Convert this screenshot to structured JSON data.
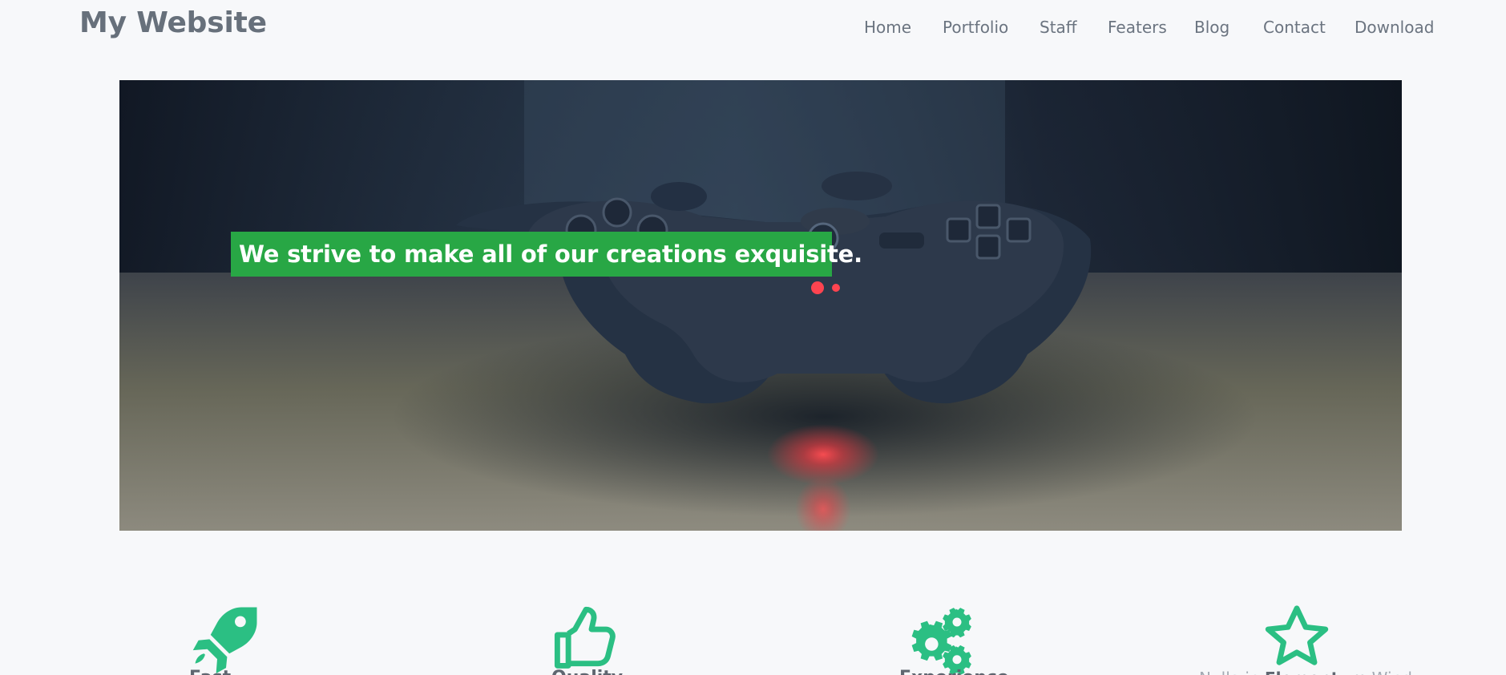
{
  "header": {
    "brand": "My Website",
    "nav": [
      {
        "label": "Home"
      },
      {
        "label": "Portfolio"
      },
      {
        "label": "Staff"
      },
      {
        "label": "Featers"
      },
      {
        "label": "Blog"
      },
      {
        "label": "Contact"
      },
      {
        "label": "Download"
      }
    ]
  },
  "hero": {
    "caption": "We strive to make all of our creations exquisite.",
    "image": "game-controller-photo",
    "accent_color": "#28a745"
  },
  "features": [
    {
      "icon": "rocket-icon",
      "title": "Fast"
    },
    {
      "icon": "thumbs-up-icon",
      "title": "Quality"
    },
    {
      "icon": "gears-icon",
      "title": "Experience"
    },
    {
      "icon": "star-icon",
      "text_before": "Nulla in ",
      "text_bold": "Elementum",
      "text_after": " Wind"
    }
  ],
  "theme": {
    "feature_icon_color": "#2bbf83",
    "text_muted": "#6b7480",
    "text_dark": "#5f6670"
  }
}
